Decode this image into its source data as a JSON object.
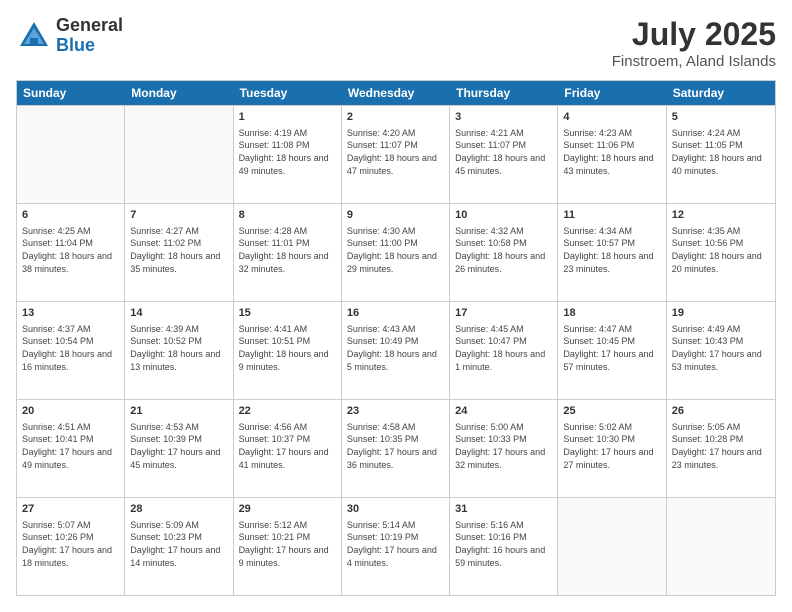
{
  "header": {
    "logo_general": "General",
    "logo_blue": "Blue",
    "title": "July 2025",
    "location": "Finstroem, Aland Islands"
  },
  "days_of_week": [
    "Sunday",
    "Monday",
    "Tuesday",
    "Wednesday",
    "Thursday",
    "Friday",
    "Saturday"
  ],
  "weeks": [
    [
      {
        "day": "",
        "empty": true
      },
      {
        "day": "",
        "empty": true
      },
      {
        "day": "1",
        "sunrise": "Sunrise: 4:19 AM",
        "sunset": "Sunset: 11:08 PM",
        "daylight": "Daylight: 18 hours and 49 minutes."
      },
      {
        "day": "2",
        "sunrise": "Sunrise: 4:20 AM",
        "sunset": "Sunset: 11:07 PM",
        "daylight": "Daylight: 18 hours and 47 minutes."
      },
      {
        "day": "3",
        "sunrise": "Sunrise: 4:21 AM",
        "sunset": "Sunset: 11:07 PM",
        "daylight": "Daylight: 18 hours and 45 minutes."
      },
      {
        "day": "4",
        "sunrise": "Sunrise: 4:23 AM",
        "sunset": "Sunset: 11:06 PM",
        "daylight": "Daylight: 18 hours and 43 minutes."
      },
      {
        "day": "5",
        "sunrise": "Sunrise: 4:24 AM",
        "sunset": "Sunset: 11:05 PM",
        "daylight": "Daylight: 18 hours and 40 minutes."
      }
    ],
    [
      {
        "day": "6",
        "sunrise": "Sunrise: 4:25 AM",
        "sunset": "Sunset: 11:04 PM",
        "daylight": "Daylight: 18 hours and 38 minutes."
      },
      {
        "day": "7",
        "sunrise": "Sunrise: 4:27 AM",
        "sunset": "Sunset: 11:02 PM",
        "daylight": "Daylight: 18 hours and 35 minutes."
      },
      {
        "day": "8",
        "sunrise": "Sunrise: 4:28 AM",
        "sunset": "Sunset: 11:01 PM",
        "daylight": "Daylight: 18 hours and 32 minutes."
      },
      {
        "day": "9",
        "sunrise": "Sunrise: 4:30 AM",
        "sunset": "Sunset: 11:00 PM",
        "daylight": "Daylight: 18 hours and 29 minutes."
      },
      {
        "day": "10",
        "sunrise": "Sunrise: 4:32 AM",
        "sunset": "Sunset: 10:58 PM",
        "daylight": "Daylight: 18 hours and 26 minutes."
      },
      {
        "day": "11",
        "sunrise": "Sunrise: 4:34 AM",
        "sunset": "Sunset: 10:57 PM",
        "daylight": "Daylight: 18 hours and 23 minutes."
      },
      {
        "day": "12",
        "sunrise": "Sunrise: 4:35 AM",
        "sunset": "Sunset: 10:56 PM",
        "daylight": "Daylight: 18 hours and 20 minutes."
      }
    ],
    [
      {
        "day": "13",
        "sunrise": "Sunrise: 4:37 AM",
        "sunset": "Sunset: 10:54 PM",
        "daylight": "Daylight: 18 hours and 16 minutes."
      },
      {
        "day": "14",
        "sunrise": "Sunrise: 4:39 AM",
        "sunset": "Sunset: 10:52 PM",
        "daylight": "Daylight: 18 hours and 13 minutes."
      },
      {
        "day": "15",
        "sunrise": "Sunrise: 4:41 AM",
        "sunset": "Sunset: 10:51 PM",
        "daylight": "Daylight: 18 hours and 9 minutes."
      },
      {
        "day": "16",
        "sunrise": "Sunrise: 4:43 AM",
        "sunset": "Sunset: 10:49 PM",
        "daylight": "Daylight: 18 hours and 5 minutes."
      },
      {
        "day": "17",
        "sunrise": "Sunrise: 4:45 AM",
        "sunset": "Sunset: 10:47 PM",
        "daylight": "Daylight: 18 hours and 1 minute."
      },
      {
        "day": "18",
        "sunrise": "Sunrise: 4:47 AM",
        "sunset": "Sunset: 10:45 PM",
        "daylight": "Daylight: 17 hours and 57 minutes."
      },
      {
        "day": "19",
        "sunrise": "Sunrise: 4:49 AM",
        "sunset": "Sunset: 10:43 PM",
        "daylight": "Daylight: 17 hours and 53 minutes."
      }
    ],
    [
      {
        "day": "20",
        "sunrise": "Sunrise: 4:51 AM",
        "sunset": "Sunset: 10:41 PM",
        "daylight": "Daylight: 17 hours and 49 minutes."
      },
      {
        "day": "21",
        "sunrise": "Sunrise: 4:53 AM",
        "sunset": "Sunset: 10:39 PM",
        "daylight": "Daylight: 17 hours and 45 minutes."
      },
      {
        "day": "22",
        "sunrise": "Sunrise: 4:56 AM",
        "sunset": "Sunset: 10:37 PM",
        "daylight": "Daylight: 17 hours and 41 minutes."
      },
      {
        "day": "23",
        "sunrise": "Sunrise: 4:58 AM",
        "sunset": "Sunset: 10:35 PM",
        "daylight": "Daylight: 17 hours and 36 minutes."
      },
      {
        "day": "24",
        "sunrise": "Sunrise: 5:00 AM",
        "sunset": "Sunset: 10:33 PM",
        "daylight": "Daylight: 17 hours and 32 minutes."
      },
      {
        "day": "25",
        "sunrise": "Sunrise: 5:02 AM",
        "sunset": "Sunset: 10:30 PM",
        "daylight": "Daylight: 17 hours and 27 minutes."
      },
      {
        "day": "26",
        "sunrise": "Sunrise: 5:05 AM",
        "sunset": "Sunset: 10:28 PM",
        "daylight": "Daylight: 17 hours and 23 minutes."
      }
    ],
    [
      {
        "day": "27",
        "sunrise": "Sunrise: 5:07 AM",
        "sunset": "Sunset: 10:26 PM",
        "daylight": "Daylight: 17 hours and 18 minutes."
      },
      {
        "day": "28",
        "sunrise": "Sunrise: 5:09 AM",
        "sunset": "Sunset: 10:23 PM",
        "daylight": "Daylight: 17 hours and 14 minutes."
      },
      {
        "day": "29",
        "sunrise": "Sunrise: 5:12 AM",
        "sunset": "Sunset: 10:21 PM",
        "daylight": "Daylight: 17 hours and 9 minutes."
      },
      {
        "day": "30",
        "sunrise": "Sunrise: 5:14 AM",
        "sunset": "Sunset: 10:19 PM",
        "daylight": "Daylight: 17 hours and 4 minutes."
      },
      {
        "day": "31",
        "sunrise": "Sunrise: 5:16 AM",
        "sunset": "Sunset: 10:16 PM",
        "daylight": "Daylight: 16 hours and 59 minutes."
      },
      {
        "day": "",
        "empty": true
      },
      {
        "day": "",
        "empty": true
      }
    ]
  ]
}
